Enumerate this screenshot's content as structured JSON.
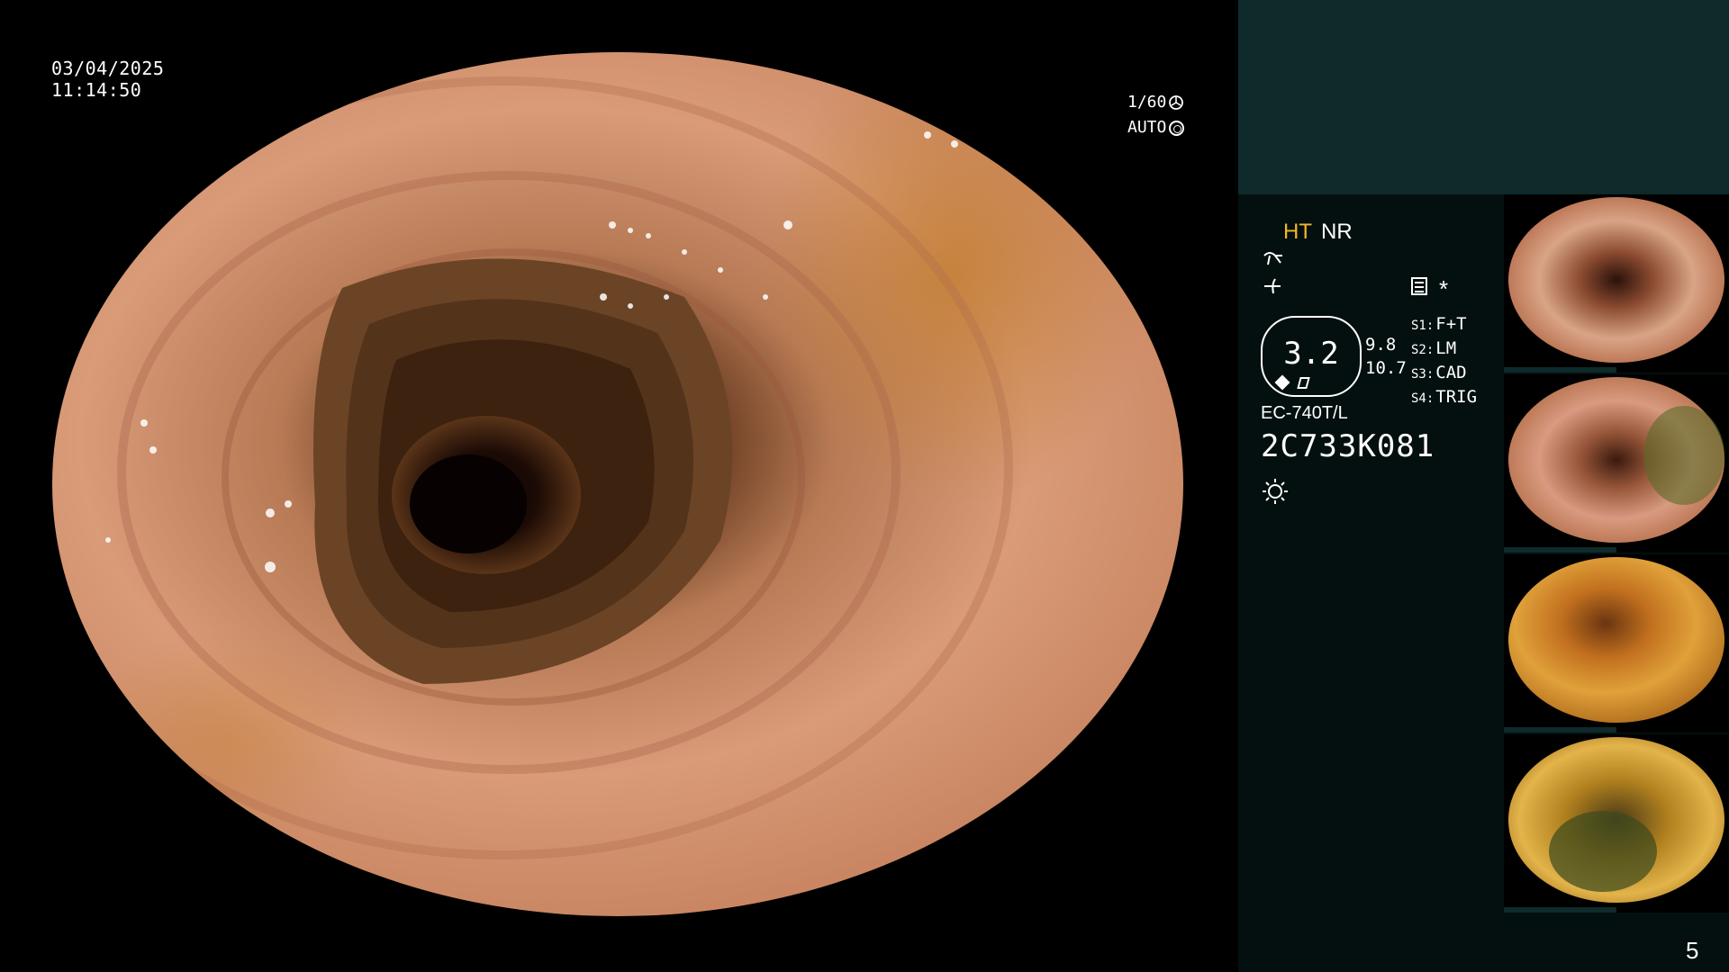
{
  "overlay": {
    "date": "03/04/2025",
    "time": "11:14:50",
    "shutter_speed": "1/60",
    "exposure_mode": "AUTO"
  },
  "processor": {
    "mode_ht": "HT",
    "mode_nr": "NR",
    "star": "*",
    "zoom": "3.2",
    "zoom_values": [
      "9.8",
      "10.7"
    ],
    "switches": [
      {
        "key": "S1:",
        "value": "F+T"
      },
      {
        "key": "S2:",
        "value": "LM"
      },
      {
        "key": "S3:",
        "value": "CAD"
      },
      {
        "key": "S4:",
        "value": "TRIG"
      }
    ],
    "scope_model": "EC-740T/L",
    "scope_serial": "2C733K081"
  },
  "icons": [
    "fan-icon",
    "aperture-icon",
    "curve-icon",
    "wave-icon",
    "settings-icon",
    "zoom-diamond-icon",
    "zoom-square-icon",
    "light-source-icon"
  ],
  "thumbnails": [
    "thumbnail-1",
    "thumbnail-2",
    "thumbnail-3",
    "thumbnail-4"
  ],
  "page_number": "5",
  "colors": {
    "panel_top": "#0f2a2b",
    "panel_bottom": "#03100f",
    "ht_accent": "#f3b62b"
  }
}
